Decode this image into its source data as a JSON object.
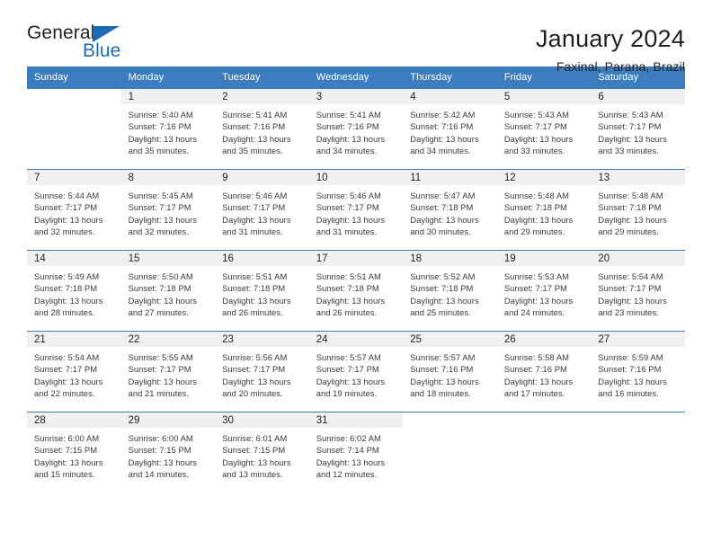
{
  "brand": {
    "name_part1": "General",
    "name_part2": "Blue",
    "accent_color": "#1b6cb5"
  },
  "header": {
    "title": "January 2024",
    "subtitle": "Faxinal, Parana, Brazil"
  },
  "calendar": {
    "header_bg": "#3b7dbf",
    "daynum_bg": "#f0f0f0",
    "weekday_headers": [
      "Sunday",
      "Monday",
      "Tuesday",
      "Wednesday",
      "Thursday",
      "Friday",
      "Saturday"
    ],
    "weeks": [
      [
        {
          "day": "",
          "sunrise": "",
          "sunset": "",
          "daylight_line1": "",
          "daylight_line2": ""
        },
        {
          "day": "1",
          "sunrise": "Sunrise: 5:40 AM",
          "sunset": "Sunset: 7:16 PM",
          "daylight_line1": "Daylight: 13 hours",
          "daylight_line2": "and 35 minutes."
        },
        {
          "day": "2",
          "sunrise": "Sunrise: 5:41 AM",
          "sunset": "Sunset: 7:16 PM",
          "daylight_line1": "Daylight: 13 hours",
          "daylight_line2": "and 35 minutes."
        },
        {
          "day": "3",
          "sunrise": "Sunrise: 5:41 AM",
          "sunset": "Sunset: 7:16 PM",
          "daylight_line1": "Daylight: 13 hours",
          "daylight_line2": "and 34 minutes."
        },
        {
          "day": "4",
          "sunrise": "Sunrise: 5:42 AM",
          "sunset": "Sunset: 7:16 PM",
          "daylight_line1": "Daylight: 13 hours",
          "daylight_line2": "and 34 minutes."
        },
        {
          "day": "5",
          "sunrise": "Sunrise: 5:43 AM",
          "sunset": "Sunset: 7:17 PM",
          "daylight_line1": "Daylight: 13 hours",
          "daylight_line2": "and 33 minutes."
        },
        {
          "day": "6",
          "sunrise": "Sunrise: 5:43 AM",
          "sunset": "Sunset: 7:17 PM",
          "daylight_line1": "Daylight: 13 hours",
          "daylight_line2": "and 33 minutes."
        }
      ],
      [
        {
          "day": "7",
          "sunrise": "Sunrise: 5:44 AM",
          "sunset": "Sunset: 7:17 PM",
          "daylight_line1": "Daylight: 13 hours",
          "daylight_line2": "and 32 minutes."
        },
        {
          "day": "8",
          "sunrise": "Sunrise: 5:45 AM",
          "sunset": "Sunset: 7:17 PM",
          "daylight_line1": "Daylight: 13 hours",
          "daylight_line2": "and 32 minutes."
        },
        {
          "day": "9",
          "sunrise": "Sunrise: 5:46 AM",
          "sunset": "Sunset: 7:17 PM",
          "daylight_line1": "Daylight: 13 hours",
          "daylight_line2": "and 31 minutes."
        },
        {
          "day": "10",
          "sunrise": "Sunrise: 5:46 AM",
          "sunset": "Sunset: 7:17 PM",
          "daylight_line1": "Daylight: 13 hours",
          "daylight_line2": "and 31 minutes."
        },
        {
          "day": "11",
          "sunrise": "Sunrise: 5:47 AM",
          "sunset": "Sunset: 7:18 PM",
          "daylight_line1": "Daylight: 13 hours",
          "daylight_line2": "and 30 minutes."
        },
        {
          "day": "12",
          "sunrise": "Sunrise: 5:48 AM",
          "sunset": "Sunset: 7:18 PM",
          "daylight_line1": "Daylight: 13 hours",
          "daylight_line2": "and 29 minutes."
        },
        {
          "day": "13",
          "sunrise": "Sunrise: 5:48 AM",
          "sunset": "Sunset: 7:18 PM",
          "daylight_line1": "Daylight: 13 hours",
          "daylight_line2": "and 29 minutes."
        }
      ],
      [
        {
          "day": "14",
          "sunrise": "Sunrise: 5:49 AM",
          "sunset": "Sunset: 7:18 PM",
          "daylight_line1": "Daylight: 13 hours",
          "daylight_line2": "and 28 minutes."
        },
        {
          "day": "15",
          "sunrise": "Sunrise: 5:50 AM",
          "sunset": "Sunset: 7:18 PM",
          "daylight_line1": "Daylight: 13 hours",
          "daylight_line2": "and 27 minutes."
        },
        {
          "day": "16",
          "sunrise": "Sunrise: 5:51 AM",
          "sunset": "Sunset: 7:18 PM",
          "daylight_line1": "Daylight: 13 hours",
          "daylight_line2": "and 26 minutes."
        },
        {
          "day": "17",
          "sunrise": "Sunrise: 5:51 AM",
          "sunset": "Sunset: 7:18 PM",
          "daylight_line1": "Daylight: 13 hours",
          "daylight_line2": "and 26 minutes."
        },
        {
          "day": "18",
          "sunrise": "Sunrise: 5:52 AM",
          "sunset": "Sunset: 7:18 PM",
          "daylight_line1": "Daylight: 13 hours",
          "daylight_line2": "and 25 minutes."
        },
        {
          "day": "19",
          "sunrise": "Sunrise: 5:53 AM",
          "sunset": "Sunset: 7:17 PM",
          "daylight_line1": "Daylight: 13 hours",
          "daylight_line2": "and 24 minutes."
        },
        {
          "day": "20",
          "sunrise": "Sunrise: 5:54 AM",
          "sunset": "Sunset: 7:17 PM",
          "daylight_line1": "Daylight: 13 hours",
          "daylight_line2": "and 23 minutes."
        }
      ],
      [
        {
          "day": "21",
          "sunrise": "Sunrise: 5:54 AM",
          "sunset": "Sunset: 7:17 PM",
          "daylight_line1": "Daylight: 13 hours",
          "daylight_line2": "and 22 minutes."
        },
        {
          "day": "22",
          "sunrise": "Sunrise: 5:55 AM",
          "sunset": "Sunset: 7:17 PM",
          "daylight_line1": "Daylight: 13 hours",
          "daylight_line2": "and 21 minutes."
        },
        {
          "day": "23",
          "sunrise": "Sunrise: 5:56 AM",
          "sunset": "Sunset: 7:17 PM",
          "daylight_line1": "Daylight: 13 hours",
          "daylight_line2": "and 20 minutes."
        },
        {
          "day": "24",
          "sunrise": "Sunrise: 5:57 AM",
          "sunset": "Sunset: 7:17 PM",
          "daylight_line1": "Daylight: 13 hours",
          "daylight_line2": "and 19 minutes."
        },
        {
          "day": "25",
          "sunrise": "Sunrise: 5:57 AM",
          "sunset": "Sunset: 7:16 PM",
          "daylight_line1": "Daylight: 13 hours",
          "daylight_line2": "and 18 minutes."
        },
        {
          "day": "26",
          "sunrise": "Sunrise: 5:58 AM",
          "sunset": "Sunset: 7:16 PM",
          "daylight_line1": "Daylight: 13 hours",
          "daylight_line2": "and 17 minutes."
        },
        {
          "day": "27",
          "sunrise": "Sunrise: 5:59 AM",
          "sunset": "Sunset: 7:16 PM",
          "daylight_line1": "Daylight: 13 hours",
          "daylight_line2": "and 16 minutes."
        }
      ],
      [
        {
          "day": "28",
          "sunrise": "Sunrise: 6:00 AM",
          "sunset": "Sunset: 7:15 PM",
          "daylight_line1": "Daylight: 13 hours",
          "daylight_line2": "and 15 minutes."
        },
        {
          "day": "29",
          "sunrise": "Sunrise: 6:00 AM",
          "sunset": "Sunset: 7:15 PM",
          "daylight_line1": "Daylight: 13 hours",
          "daylight_line2": "and 14 minutes."
        },
        {
          "day": "30",
          "sunrise": "Sunrise: 6:01 AM",
          "sunset": "Sunset: 7:15 PM",
          "daylight_line1": "Daylight: 13 hours",
          "daylight_line2": "and 13 minutes."
        },
        {
          "day": "31",
          "sunrise": "Sunrise: 6:02 AM",
          "sunset": "Sunset: 7:14 PM",
          "daylight_line1": "Daylight: 13 hours",
          "daylight_line2": "and 12 minutes."
        },
        {
          "day": "",
          "sunrise": "",
          "sunset": "",
          "daylight_line1": "",
          "daylight_line2": ""
        },
        {
          "day": "",
          "sunrise": "",
          "sunset": "",
          "daylight_line1": "",
          "daylight_line2": ""
        },
        {
          "day": "",
          "sunrise": "",
          "sunset": "",
          "daylight_line1": "",
          "daylight_line2": ""
        }
      ]
    ]
  }
}
